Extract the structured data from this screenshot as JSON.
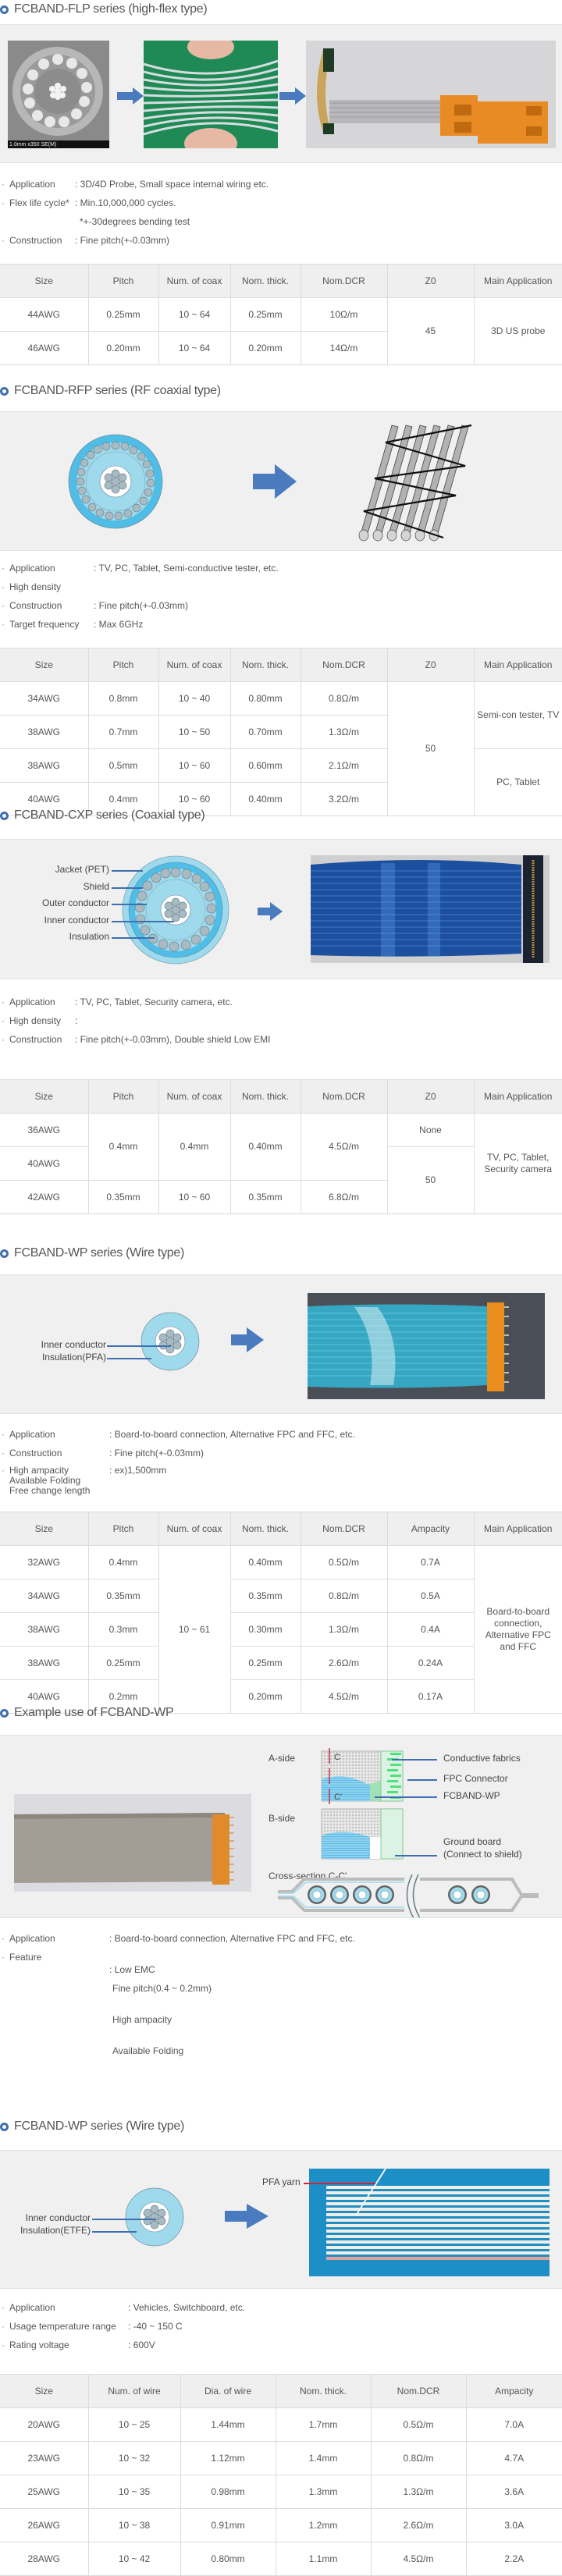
{
  "sections": {
    "flp": {
      "title": "FCBAND-FLP series (high-flex type)",
      "photo_caption": "1.0mm x350 SE(M)",
      "specs": [
        {
          "label": "Application",
          "value": ": 3D/4D Probe, Small space internal wiring etc."
        },
        {
          "label": "Flex life cycle*",
          "value": ": Min.10,000,000 cycles.",
          "continuation": "*+-30degrees bending test"
        },
        {
          "label": "Construction",
          "value": ": Fine pitch(+-0.03mm)"
        }
      ],
      "table": {
        "headers": [
          "Size",
          "Pitch",
          "Num. of coax",
          "Nom. thick.",
          "Nom.DCR",
          "Z0",
          "Main Application"
        ],
        "rows": [
          [
            "44AWG",
            "0.25mm",
            "10 ~ 64",
            "0.25mm",
            "10Ω/m"
          ],
          [
            "46AWG",
            "0.20mm",
            "10 ~ 64",
            "0.20mm",
            "14Ω/m"
          ]
        ],
        "z0": "45",
        "main_application": "3D US probe"
      }
    },
    "rfp": {
      "title": "FCBAND-RFP series (RF coaxial type)",
      "specs": [
        {
          "label": "Application",
          "value": ": TV, PC, Tablet, Semi-conductive tester, etc."
        },
        {
          "label": "High density",
          "value": ""
        },
        {
          "label": "Construction",
          "value": ": Fine pitch(+-0.03mm)"
        },
        {
          "label": "Target frequency",
          "value": ": Max 6GHz"
        }
      ],
      "table": {
        "headers": [
          "Size",
          "Pitch",
          "Num. of coax",
          "Nom. thick.",
          "Nom.DCR",
          "Z0",
          "Main Application"
        ],
        "rows": [
          [
            "34AWG",
            "0.8mm",
            "10 ~ 40",
            "0.80mm",
            "0.8Ω/m"
          ],
          [
            "38AWG",
            "0.7mm",
            "10 ~ 50",
            "0.70mm",
            "1.3Ω/m"
          ],
          [
            "38AWG",
            "0.5mm",
            "10 ~ 60",
            "0.60mm",
            "2.1Ω/m"
          ],
          [
            "40AWG",
            "0.4mm",
            "10 ~ 60",
            "0.40mm",
            "3.2Ω/m"
          ]
        ],
        "z0": "50",
        "main_application_a": "Semi-con tester, TV",
        "main_application_b": "PC, Tablet"
      }
    },
    "cxp": {
      "title": "FCBAND-CXP series (Coaxial type)",
      "diagram_labels": [
        "Jacket (PET)",
        "Shield",
        "Outer conductor",
        "Inner conductor",
        "Insulation"
      ],
      "specs": [
        {
          "label": "Application",
          "value": ": TV, PC, Tablet, Security camera, etc."
        },
        {
          "label": "High density",
          "value": ":"
        },
        {
          "label": "Construction",
          "value": ": Fine pitch(+-0.03mm), Double shield  Low EMI"
        }
      ],
      "table": {
        "headers": [
          "Size",
          "Pitch",
          "Num. of coax",
          "Nom. thick.",
          "Nom.DCR",
          "Z0",
          "Main Application"
        ],
        "sizes": [
          "36AWG",
          "40AWG",
          "42AWG"
        ],
        "merged_pitch": "0.4mm",
        "merged_coax": "0.4mm",
        "merged_thick": "0.40mm",
        "merged_dcr": "4.5Ω/m",
        "row3": {
          "pitch": "0.35mm",
          "coax": "10 ~ 60",
          "thick": "0.35mm",
          "dcr": "6.8Ω/m"
        },
        "z0_a": "None",
        "z0_b": "50",
        "main_application": "TV, PC, Tablet, Security camera"
      }
    },
    "wp": {
      "title": "FCBAND-WP series (Wire type)",
      "diagram_labels": [
        "Inner conductor",
        "Insulation(PFA)"
      ],
      "specs": [
        {
          "label": "Application",
          "value": ": Board-to-board connection, Alternative FPC and FFC, etc."
        },
        {
          "label": "Construction",
          "value": ": Fine pitch(+-0.03mm)"
        },
        {
          "label": "High ampacity\nAvailable Folding\nFree change length",
          "value": ": ex)1,500mm"
        }
      ],
      "table": {
        "headers": [
          "Size",
          "Pitch",
          "Num. of coax",
          "Nom. thick.",
          "Nom.DCR",
          "Ampacity",
          "Main Application"
        ],
        "rows": [
          [
            "32AWG",
            "0.4mm",
            "0.40mm",
            "0.5Ω/m",
            "0.7A"
          ],
          [
            "34AWG",
            "0.35mm",
            "0.35mm",
            "0.8Ω/m",
            "0.5A"
          ],
          [
            "38AWG",
            "0.3mm",
            "0.30mm",
            "1.3Ω/m",
            "0.4A"
          ],
          [
            "38AWG",
            "0.25mm",
            "0.25mm",
            "2.6Ω/m",
            "0.24A"
          ],
          [
            "40AWG",
            "0.2mm",
            "0.20mm",
            "4.5Ω/m",
            "0.17A"
          ]
        ],
        "merged_coax": "10 ~ 61",
        "main_application": "Board-to-board connection, Alternative FPC and FFC"
      }
    },
    "example": {
      "title": "Example use of FCBAND-WP",
      "side_a": "A-side",
      "side_b": "B-side",
      "mark_c": "C",
      "mark_c2": "C'",
      "callouts": [
        "Conductive fabrics",
        "FPC Connector",
        "FCBAND-WP",
        "Ground board\n(Connect to shield)"
      ],
      "cross_section": "Cross-section C-C'",
      "specs": [
        {
          "label": "Application",
          "value": ": Board-to-board connection, Alternative FPC and FFC, etc."
        },
        {
          "label": "Feature",
          "value": ": Low EMC",
          "continuation_lines": [
            "Fine pitch(0.4 ~ 0.2mm)",
            "High ampacity",
            "Available Folding"
          ]
        }
      ]
    },
    "wp2": {
      "title": "FCBAND-WP series (Wire type)",
      "diagram_labels": [
        "Inner conductor",
        "Insulation(ETFE)"
      ],
      "photo_label": "PFA yarn",
      "specs": [
        {
          "label": "Application",
          "value": ": Vehicles, Switchboard, etc."
        },
        {
          "label": "Usage temperature range",
          "value": ": -40 ~ 150 C"
        },
        {
          "label": "Rating voltage",
          "value": ": 600V"
        }
      ],
      "table": {
        "headers": [
          "Size",
          "Num. of wire",
          "Dia. of wire",
          "Nom. thick.",
          "Nom.DCR",
          "Ampacity"
        ],
        "rows": [
          [
            "20AWG",
            "10 ~ 25",
            "1.44mm",
            "1.7mm",
            "0.5Ω/m",
            "7.0A"
          ],
          [
            "23AWG",
            "10 ~ 32",
            "1.12mm",
            "1.4mm",
            "0.8Ω/m",
            "4.7A"
          ],
          [
            "25AWG",
            "10 ~ 35",
            "0.98mm",
            "1.3mm",
            "1.3Ω/m",
            "3.6A"
          ],
          [
            "26AWG",
            "10 ~ 38",
            "0.91mm",
            "1.2mm",
            "2.6Ω/m",
            "3.0A"
          ],
          [
            "28AWG",
            "10 ~ 42",
            "0.80mm",
            "1.1mm",
            "4.5Ω/m",
            "2.2A"
          ]
        ]
      }
    }
  },
  "colors": {
    "accent": "#3e6fae",
    "figure_bg": "#f0f0f0",
    "table_header_bg": "#efefef",
    "border": "#dcdcdc",
    "cable_blue": "#4fbde6",
    "cable_light": "#9fd9ec"
  }
}
